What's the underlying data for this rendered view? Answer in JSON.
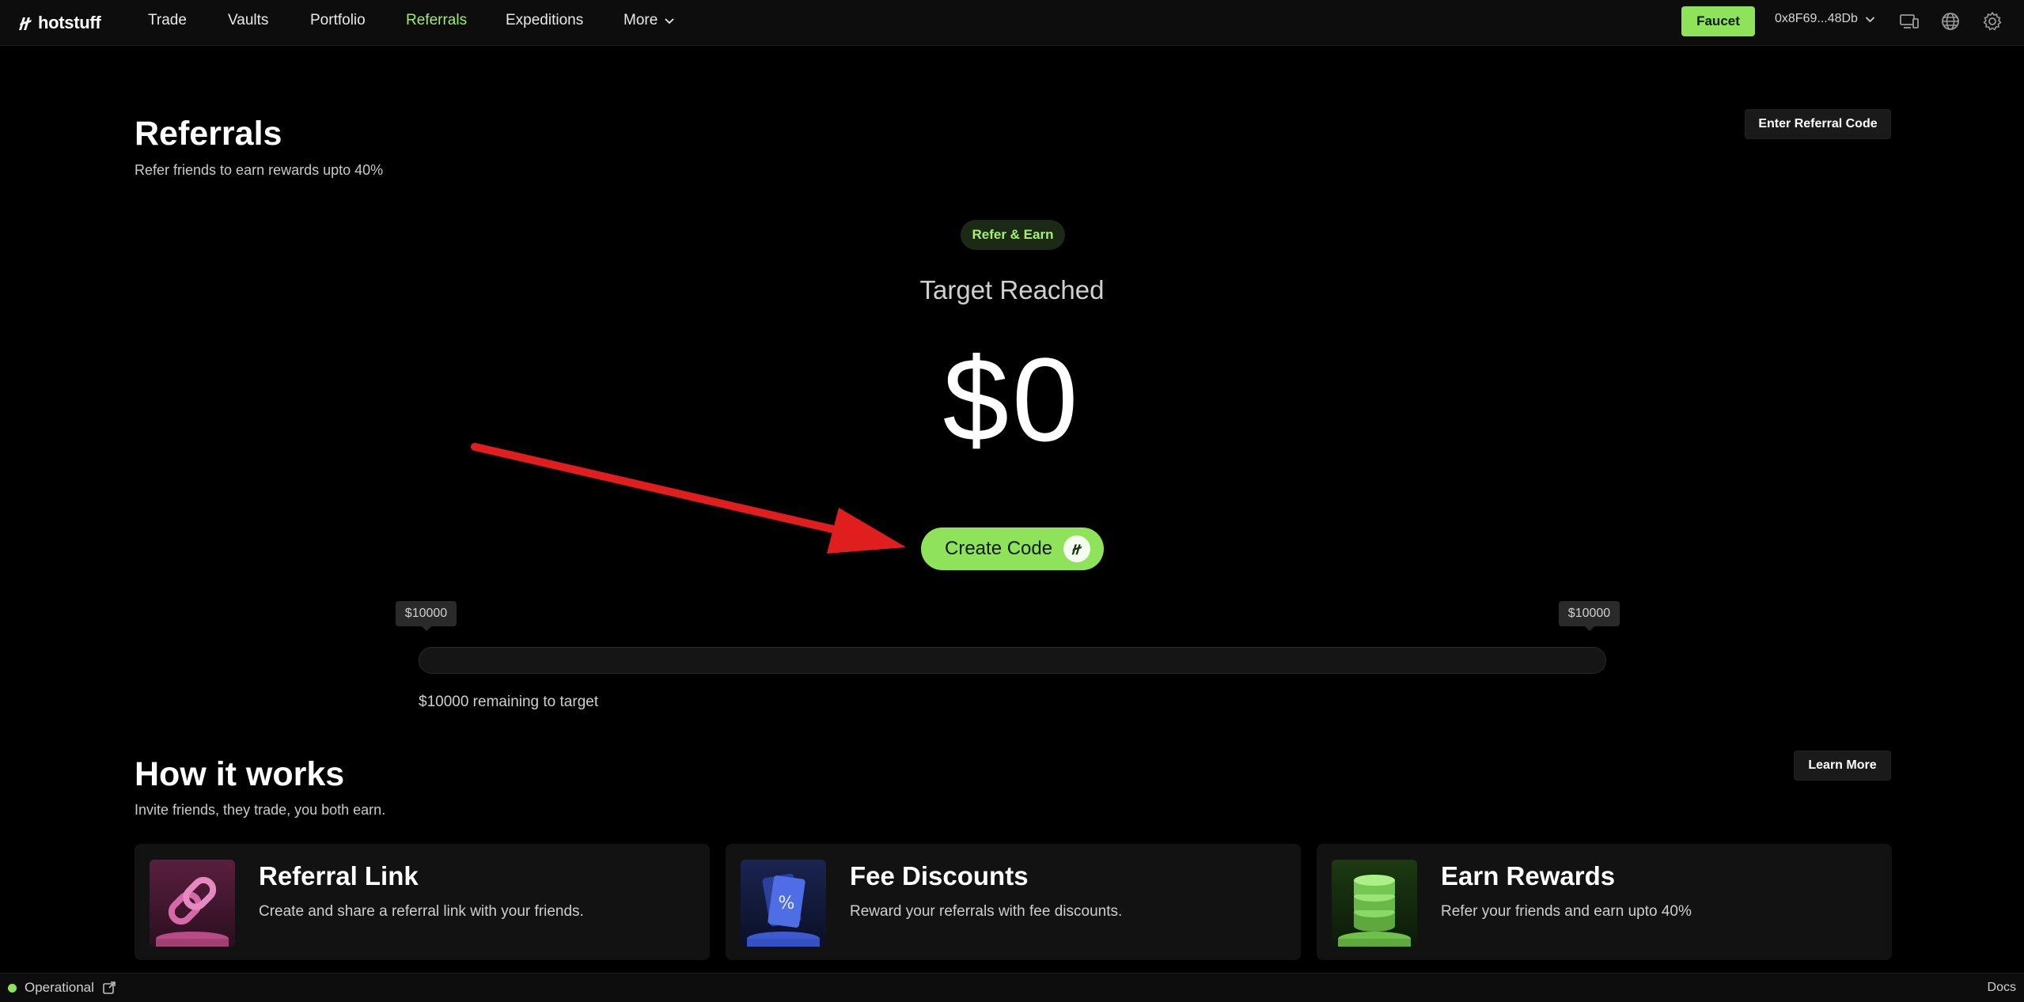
{
  "nav": {
    "logo_text": "hotstuff",
    "items": [
      "Trade",
      "Vaults",
      "Portfolio",
      "Referrals",
      "Expeditions",
      "More"
    ],
    "active": "Referrals",
    "faucet_label": "Faucet",
    "wallet_address": "0x8F69...48Db"
  },
  "header": {
    "title": "Referrals",
    "subtitle": "Refer friends to earn rewards upto 40%",
    "enter_code_label": "Enter Referral Code"
  },
  "hero": {
    "badge": "Refer & Earn",
    "target_label": "Target Reached",
    "amount": "$0",
    "create_code_label": "Create Code"
  },
  "progress": {
    "left_tag": "$10000",
    "right_tag": "$10000",
    "fraction": 0,
    "remaining_text": "$10000 remaining to target"
  },
  "how": {
    "title": "How it works",
    "subtitle": "Invite friends, they trade, you both earn.",
    "learn_more_label": "Learn More",
    "cards": [
      {
        "title": "Referral Link",
        "desc": "Create and share a referral link with your friends.",
        "icon": "chain-link-icon"
      },
      {
        "title": "Fee Discounts",
        "desc": "Reward your referrals with fee discounts.",
        "icon": "discount-ticket-icon"
      },
      {
        "title": "Earn Rewards",
        "desc": "Refer your friends and earn upto 40%",
        "icon": "coin-stack-icon"
      }
    ]
  },
  "footer": {
    "status": "Operational",
    "docs": "Docs"
  },
  "colors": {
    "accent": "#8ee35b",
    "active_nav": "#9df061",
    "annotation_arrow": "#e01e1e"
  }
}
